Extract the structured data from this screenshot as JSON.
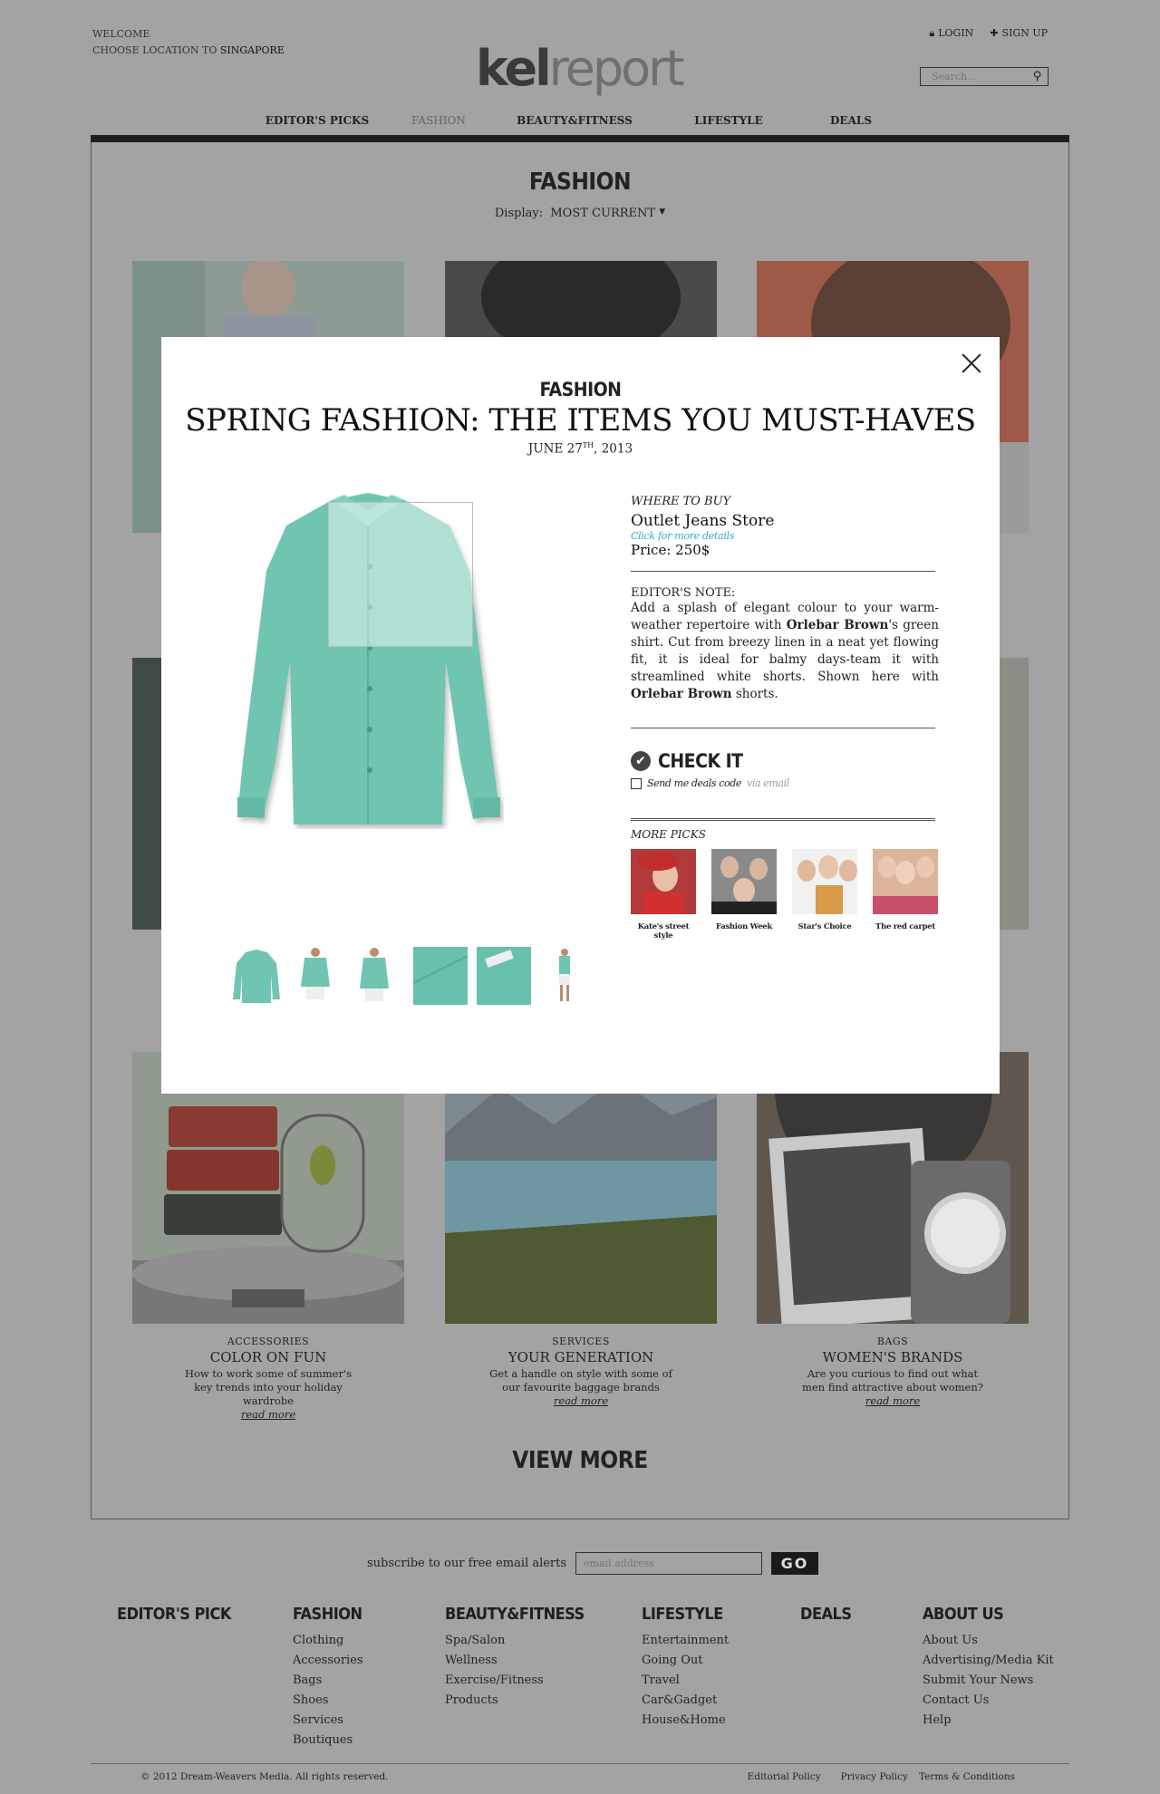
{
  "header": {
    "welcome": "WELCOME",
    "location_prefix": "CHOOSE LOCATION TO",
    "location": "SINGAPORE",
    "logo_part1": "kel",
    "logo_part2": "report",
    "login": "LOGIN",
    "signup": "SIGN UP",
    "search_placeholder": "Search..."
  },
  "nav": {
    "items": [
      {
        "label": "EDITOR'S PICKS"
      },
      {
        "label": "FASHION"
      },
      {
        "label": "BEAUTY&FITNESS"
      },
      {
        "label": "LIFESTYLE"
      },
      {
        "label": "DEALS"
      }
    ],
    "active_index": 1
  },
  "section": {
    "title": "FASHION",
    "display_label": "Display:",
    "display_value": "MOST CURRENT"
  },
  "cards": [
    {
      "kicker": "ACCESSORIES",
      "title": "COLOR ON FUN",
      "desc": "How to work some of summer's key trends into your holiday wardrobe",
      "read_more": "read more"
    },
    {
      "kicker": "SERVICES",
      "title": "YOUR GENERATION",
      "desc": "Get a handle on style with some of our favourite baggage brands",
      "read_more": "read more"
    },
    {
      "kicker": "BAGS",
      "title": "WOMEN'S BRANDS",
      "desc": "Are you curious to find out what men find attractive about women?",
      "read_more": "read more"
    }
  ],
  "view_more": "VIEW MORE",
  "subscribe": {
    "label": "subscribe to our free email alerts",
    "placeholder": "email address",
    "go": "GO"
  },
  "footer": {
    "columns": [
      {
        "heading": "EDITOR'S PICK",
        "items": []
      },
      {
        "heading": "FASHION",
        "items": [
          "Clothing",
          "Accessories",
          "Bags",
          "Shoes",
          "Services",
          "Boutiques"
        ]
      },
      {
        "heading": "BEAUTY&FITNESS",
        "items": [
          "Spa/Salon",
          "Wellness",
          "Exercise/Fitness",
          "Products"
        ]
      },
      {
        "heading": "LIFESTYLE",
        "items": [
          "Entertainment",
          "Going Out",
          "Travel",
          "Car&Gadget",
          "House&Home"
        ]
      },
      {
        "heading": "DEALS",
        "items": []
      },
      {
        "heading": "ABOUT US",
        "items": [
          "About Us",
          "Advertising/Media Kit",
          "Submit Your News",
          "Contact Us",
          "Help"
        ]
      }
    ],
    "copyright": "© 2012 Dream-Weavers Media. All rights reserved.",
    "links": [
      "Editorial Policy",
      "Privacy Policy",
      "Terms & Conditions"
    ]
  },
  "modal": {
    "category": "FASHION",
    "title": "SPRING FASHION: THE ITEMS YOU MUST-HAVES",
    "date_prefix": "JUNE 27",
    "date_sup": "TH",
    "date_suffix": ", 2013",
    "where_to_buy": "WHERE TO BUY",
    "store": "Outlet Jeans Store",
    "more_details": "Click for more details",
    "price": "Price: 250$",
    "editors_note_heading": "EDITOR'S NOTE:",
    "note_1": "Add a splash of elegant colour to your warm-weather repertoire with ",
    "note_brand_1": "Orlebar Brown",
    "note_2": "'s green shirt. Cut from breezy linen in a neat yet flowing fit, it is ideal for balmy days-team it with streamlined white shorts. Shown here with ",
    "note_brand_2": "Orlebar Brown",
    "note_3": " shorts.",
    "check_it": "CHECK IT",
    "deals_label": "Send me deals code",
    "deals_via": "via email",
    "more_picks": "MORE PICKS",
    "picks": [
      {
        "label": "Kate's street style"
      },
      {
        "label": "Fashion Week"
      },
      {
        "label": "Star's Choice"
      },
      {
        "label": "The red carpet"
      }
    ]
  },
  "colors": {
    "overlay": "#a3a3a3",
    "shirt": "#6fc5b0",
    "link": "#35a9c6",
    "nav_bar": "#1f1f1f"
  }
}
